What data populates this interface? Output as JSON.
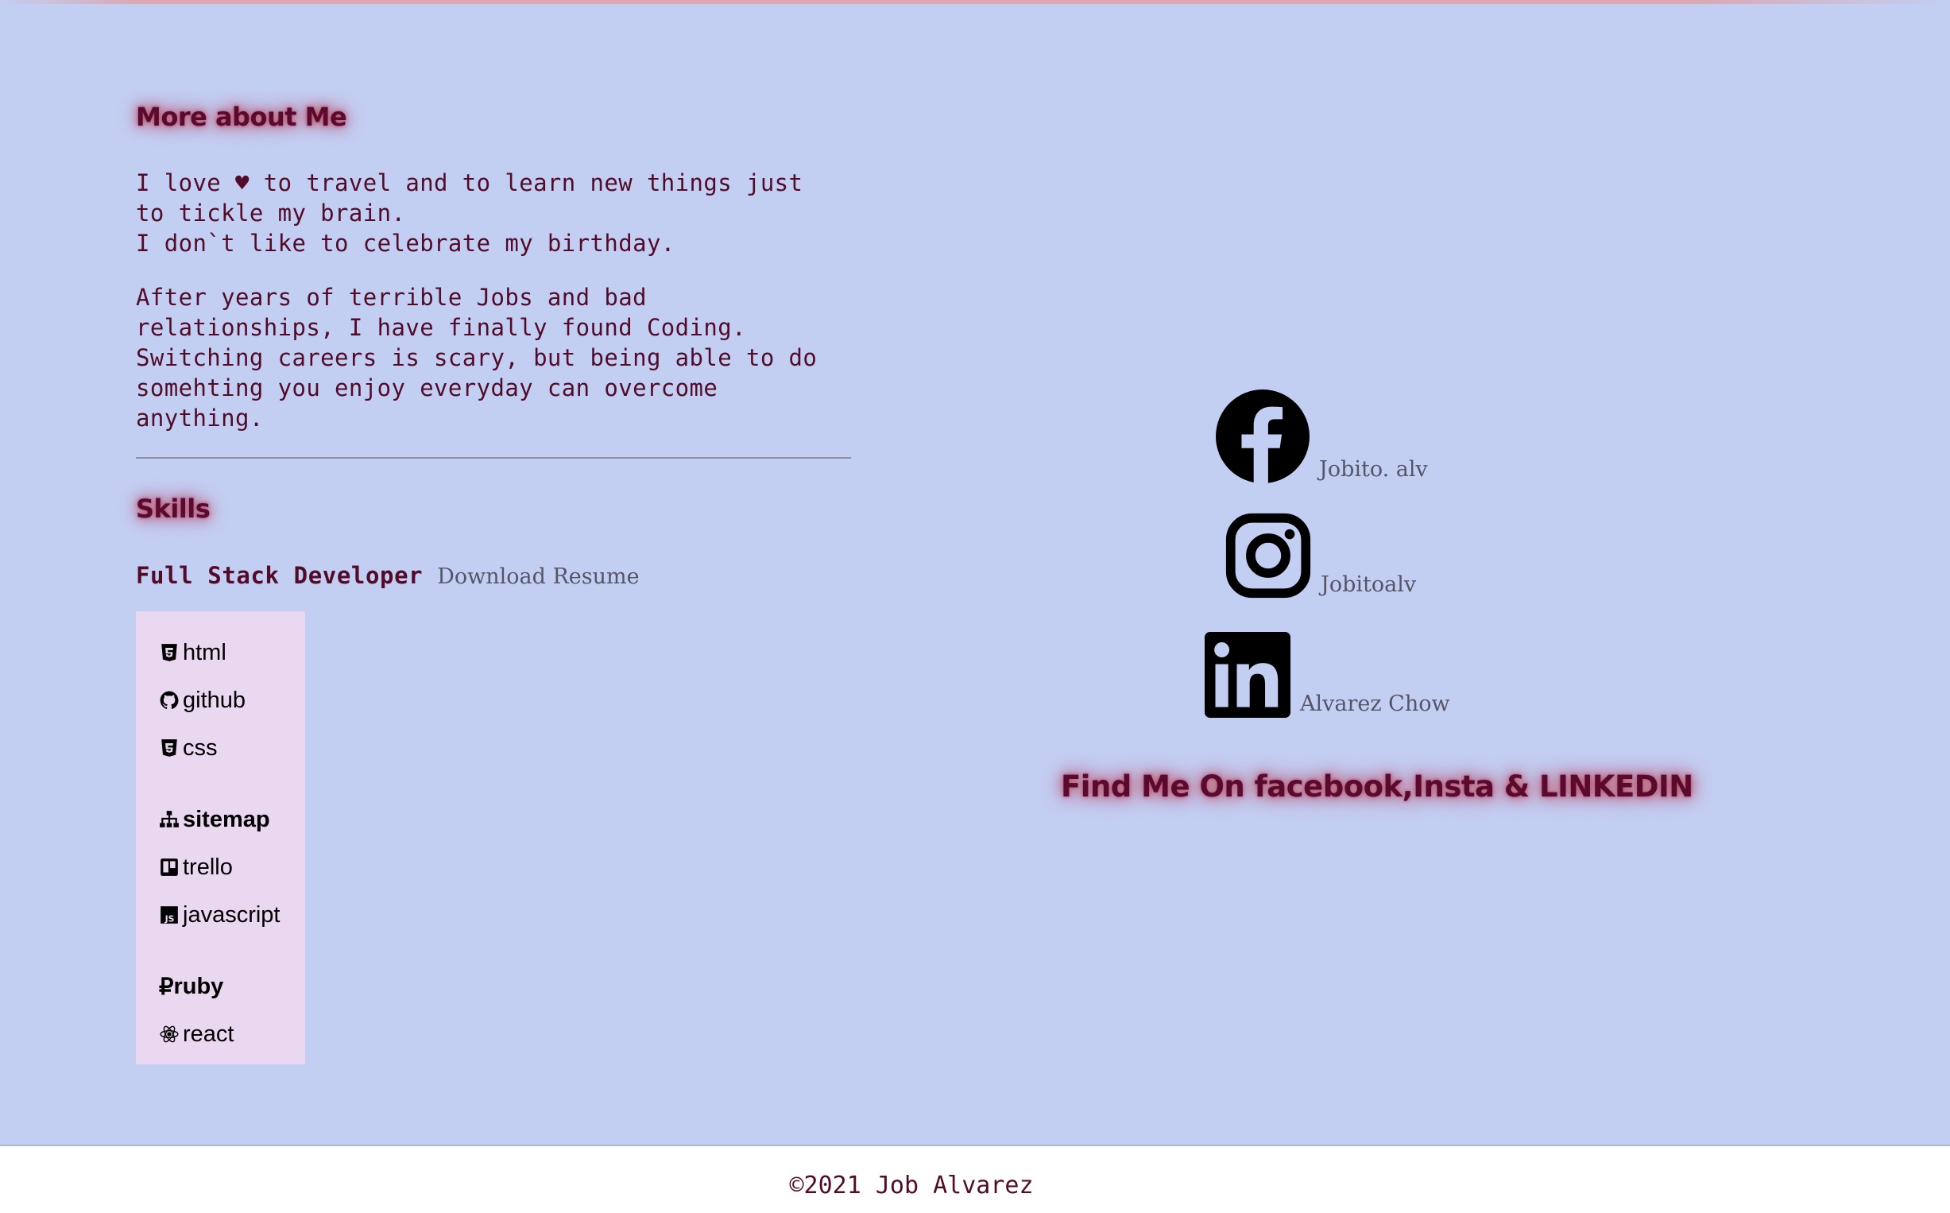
{
  "about": {
    "heading": "More about Me",
    "para1_lines": [
      "I love ♥ to travel and to learn new things just",
      "to tickle my brain.",
      "I don`t like to celebrate my birthday."
    ],
    "para2_lines": [
      "After years of terrible Jobs and bad",
      "relationships, I have finally found Coding.",
      "Switching careers is scary, but being able to do",
      "somehting you enjoy everyday can overcome",
      "anything."
    ]
  },
  "skills": {
    "heading": "Skills",
    "role": "Full Stack Developer",
    "resume_link": "Download Resume",
    "groups": [
      [
        {
          "label": "html",
          "icon": "html5-icon",
          "bold": false
        },
        {
          "label": "github",
          "icon": "github-icon",
          "bold": false
        },
        {
          "label": "css",
          "icon": "css3-icon",
          "bold": false
        }
      ],
      [
        {
          "label": "sitemap",
          "icon": "sitemap-icon",
          "bold": true
        },
        {
          "label": "trello",
          "icon": "trello-icon",
          "bold": false
        },
        {
          "label": "javascript",
          "icon": "javascript-icon",
          "bold": false
        }
      ],
      [
        {
          "label": "ruby",
          "icon": "ruble-icon",
          "bold": true
        },
        {
          "label": "react",
          "icon": "react-icon",
          "bold": false
        }
      ]
    ]
  },
  "socials": {
    "facebook": {
      "label": "Jobito. alv",
      "icon": "facebook-icon"
    },
    "instagram": {
      "label": "Jobitoalv",
      "icon": "instagram-icon"
    },
    "linkedin": {
      "label": "Alvarez Chow",
      "icon": "linkedin-icon"
    },
    "find_me": "Find Me On facebook,Insta & LINKEDIN"
  },
  "footer": {
    "copyright": "©2021 Job Alvarez"
  },
  "colors": {
    "background": "#c3cff2",
    "text": "#520c2a",
    "skill_box": "#ead8f0",
    "footer": "#ffffff"
  }
}
